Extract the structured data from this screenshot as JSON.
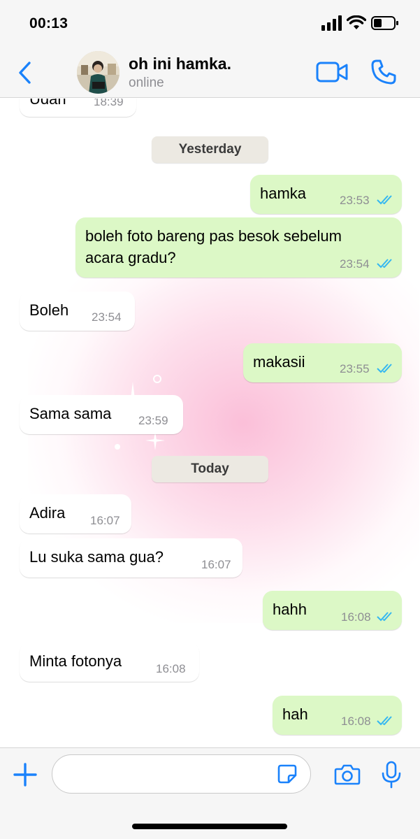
{
  "status_bar": {
    "time": "00:13"
  },
  "header": {
    "contact_name": "oh ini hamka.",
    "contact_status": "online",
    "accent_color": "#1a82fb"
  },
  "chat": {
    "partial_message": {
      "text": "Udah",
      "time": "18:39"
    },
    "day_labels": {
      "yesterday": "Yesterday",
      "today": "Today"
    },
    "messages": [
      {
        "direction": "out",
        "text": "hamka",
        "time": "23:53",
        "read": true
      },
      {
        "direction": "out",
        "text": "boleh foto bareng pas besok sebelum",
        "text2": "acara gradu?",
        "time": "23:54",
        "read": true
      },
      {
        "direction": "in",
        "text": "Boleh",
        "time": "23:54"
      },
      {
        "direction": "out",
        "text": "makasii",
        "time": "23:55",
        "read": true
      },
      {
        "direction": "in",
        "text": "Sama sama",
        "time": "23:59"
      },
      {
        "direction": "in",
        "text": "Adira",
        "time": "16:07"
      },
      {
        "direction": "in",
        "text": "Lu suka sama gua?",
        "time": "16:07"
      },
      {
        "direction": "out",
        "text": "hahh",
        "time": "16:08",
        "read": true
      },
      {
        "direction": "in",
        "text": "Minta fotonya",
        "time": "16:08"
      },
      {
        "direction": "out",
        "text": "hah",
        "time": "16:08",
        "read": true
      }
    ],
    "colors": {
      "outgoing_bubble": "#dcf8c6",
      "incoming_bubble": "#ffffff",
      "read_ticks": "#34b7f1"
    }
  },
  "input_bar": {
    "placeholder": ""
  },
  "icons": {
    "back": "chevron-left-icon",
    "video": "video-camera-icon",
    "call": "phone-icon",
    "attach": "plus-icon",
    "sticker": "sticker-icon",
    "camera": "camera-icon",
    "mic": "microphone-icon"
  }
}
